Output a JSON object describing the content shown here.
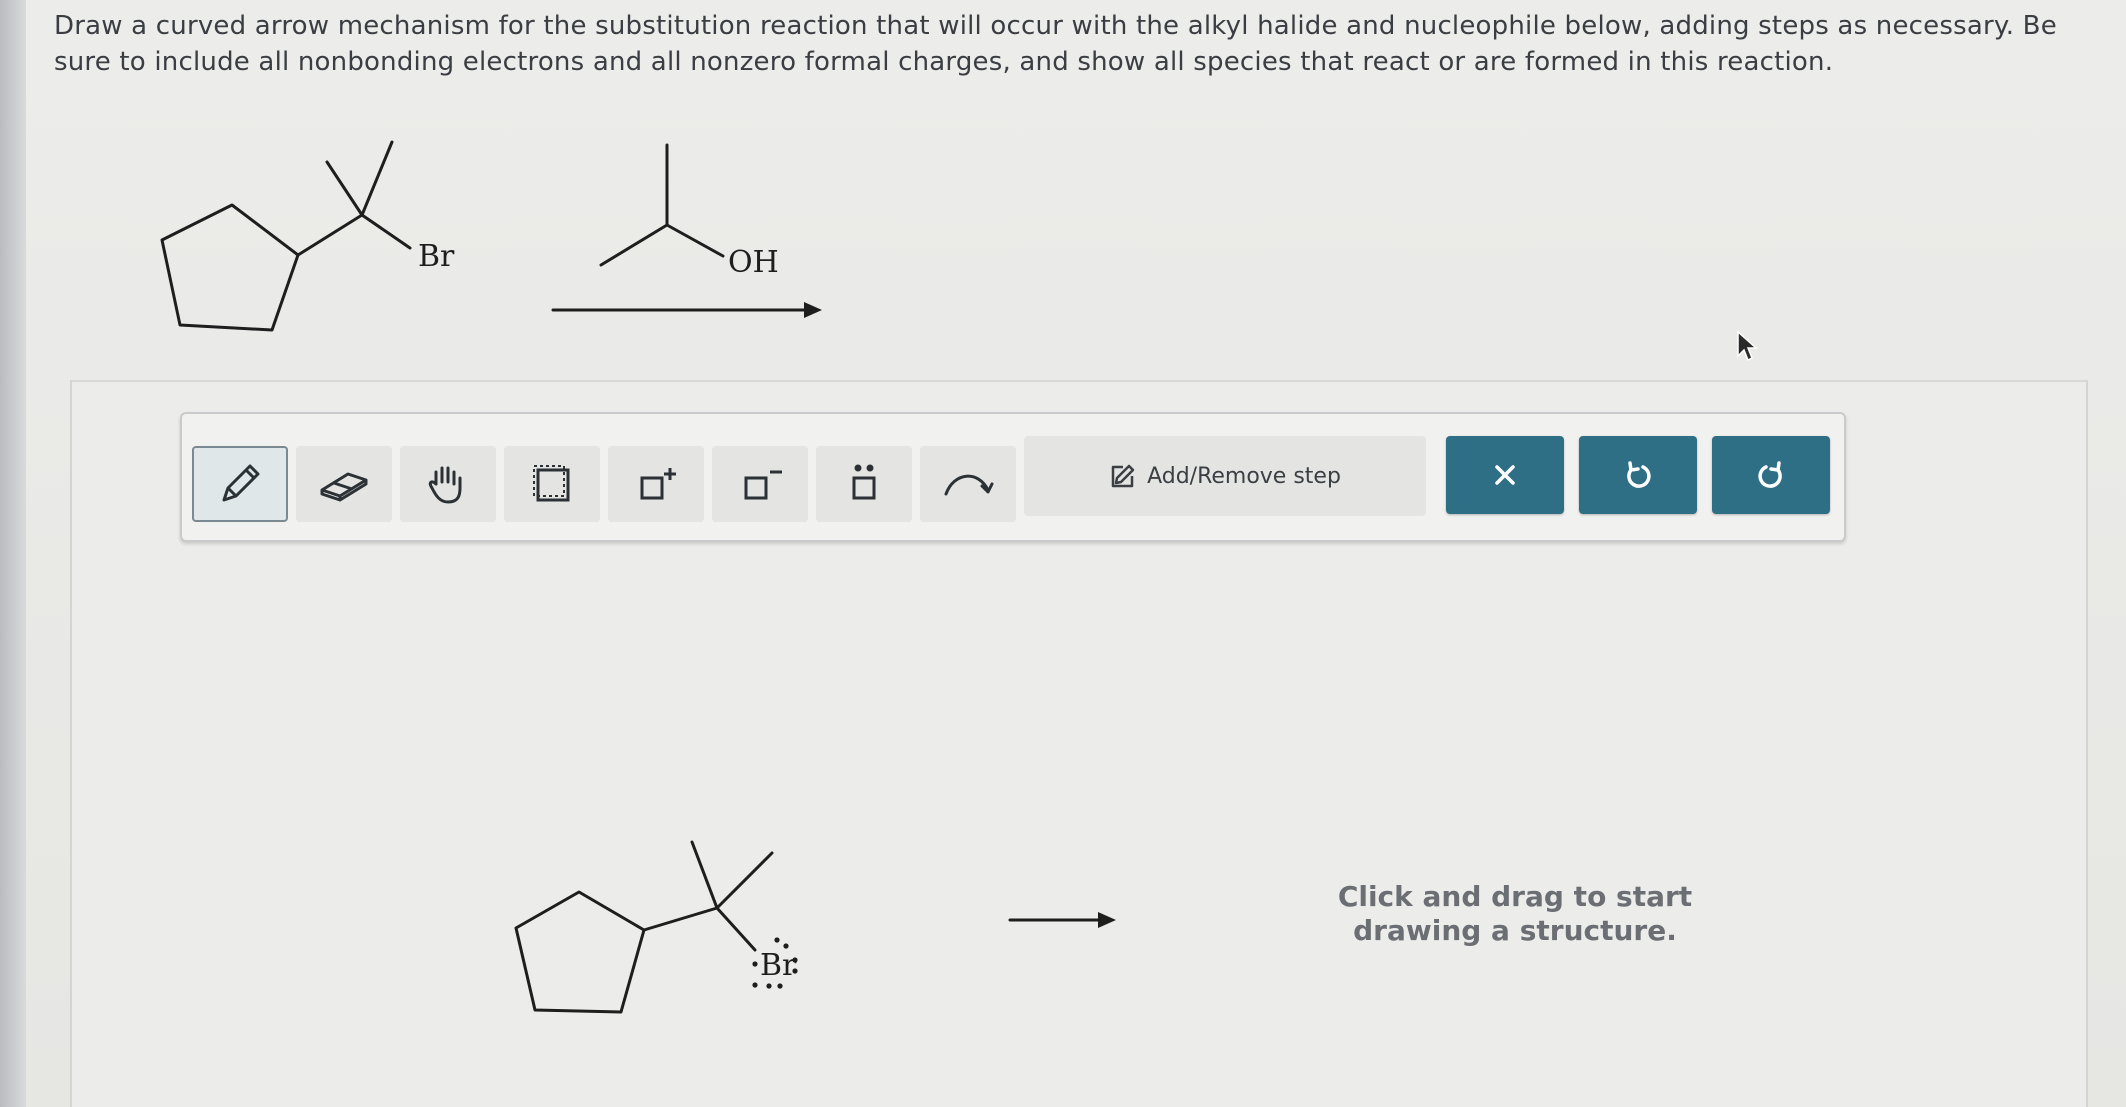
{
  "instructions": "Draw a curved arrow mechanism for the substitution reaction that will occur with the alkyl halide and nucleophile below, adding steps as necessary. Be sure to include all nonbonding electrons and all nonzero formal charges, and show all species that react or are formed in this reaction.",
  "reaction": {
    "substrate_label": "Br",
    "reagent_label": "OH"
  },
  "toolbar": {
    "tools": [
      {
        "name": "pencil",
        "icon": "pencil-icon",
        "active": true
      },
      {
        "name": "eraser",
        "icon": "eraser-icon",
        "active": false
      },
      {
        "name": "hand",
        "icon": "hand-icon",
        "active": false
      },
      {
        "name": "select",
        "icon": "selection-box-icon",
        "active": false
      },
      {
        "name": "positive-charge",
        "icon": "positive-charge-icon",
        "active": false
      },
      {
        "name": "negative-charge",
        "icon": "negative-charge-icon",
        "active": false
      },
      {
        "name": "lone-pair",
        "icon": "lone-pair-icon",
        "active": false
      },
      {
        "name": "curved-arrow",
        "icon": "curved-arrow-icon",
        "active": false
      }
    ],
    "add_step_label": "Add/Remove step",
    "clear_icon": "close-icon",
    "undo_icon": "undo-icon",
    "redo_icon": "redo-icon",
    "accent_color": "#2f6f86"
  },
  "canvas": {
    "structure_label": "Br",
    "hint": "Click and drag to start drawing a structure."
  }
}
